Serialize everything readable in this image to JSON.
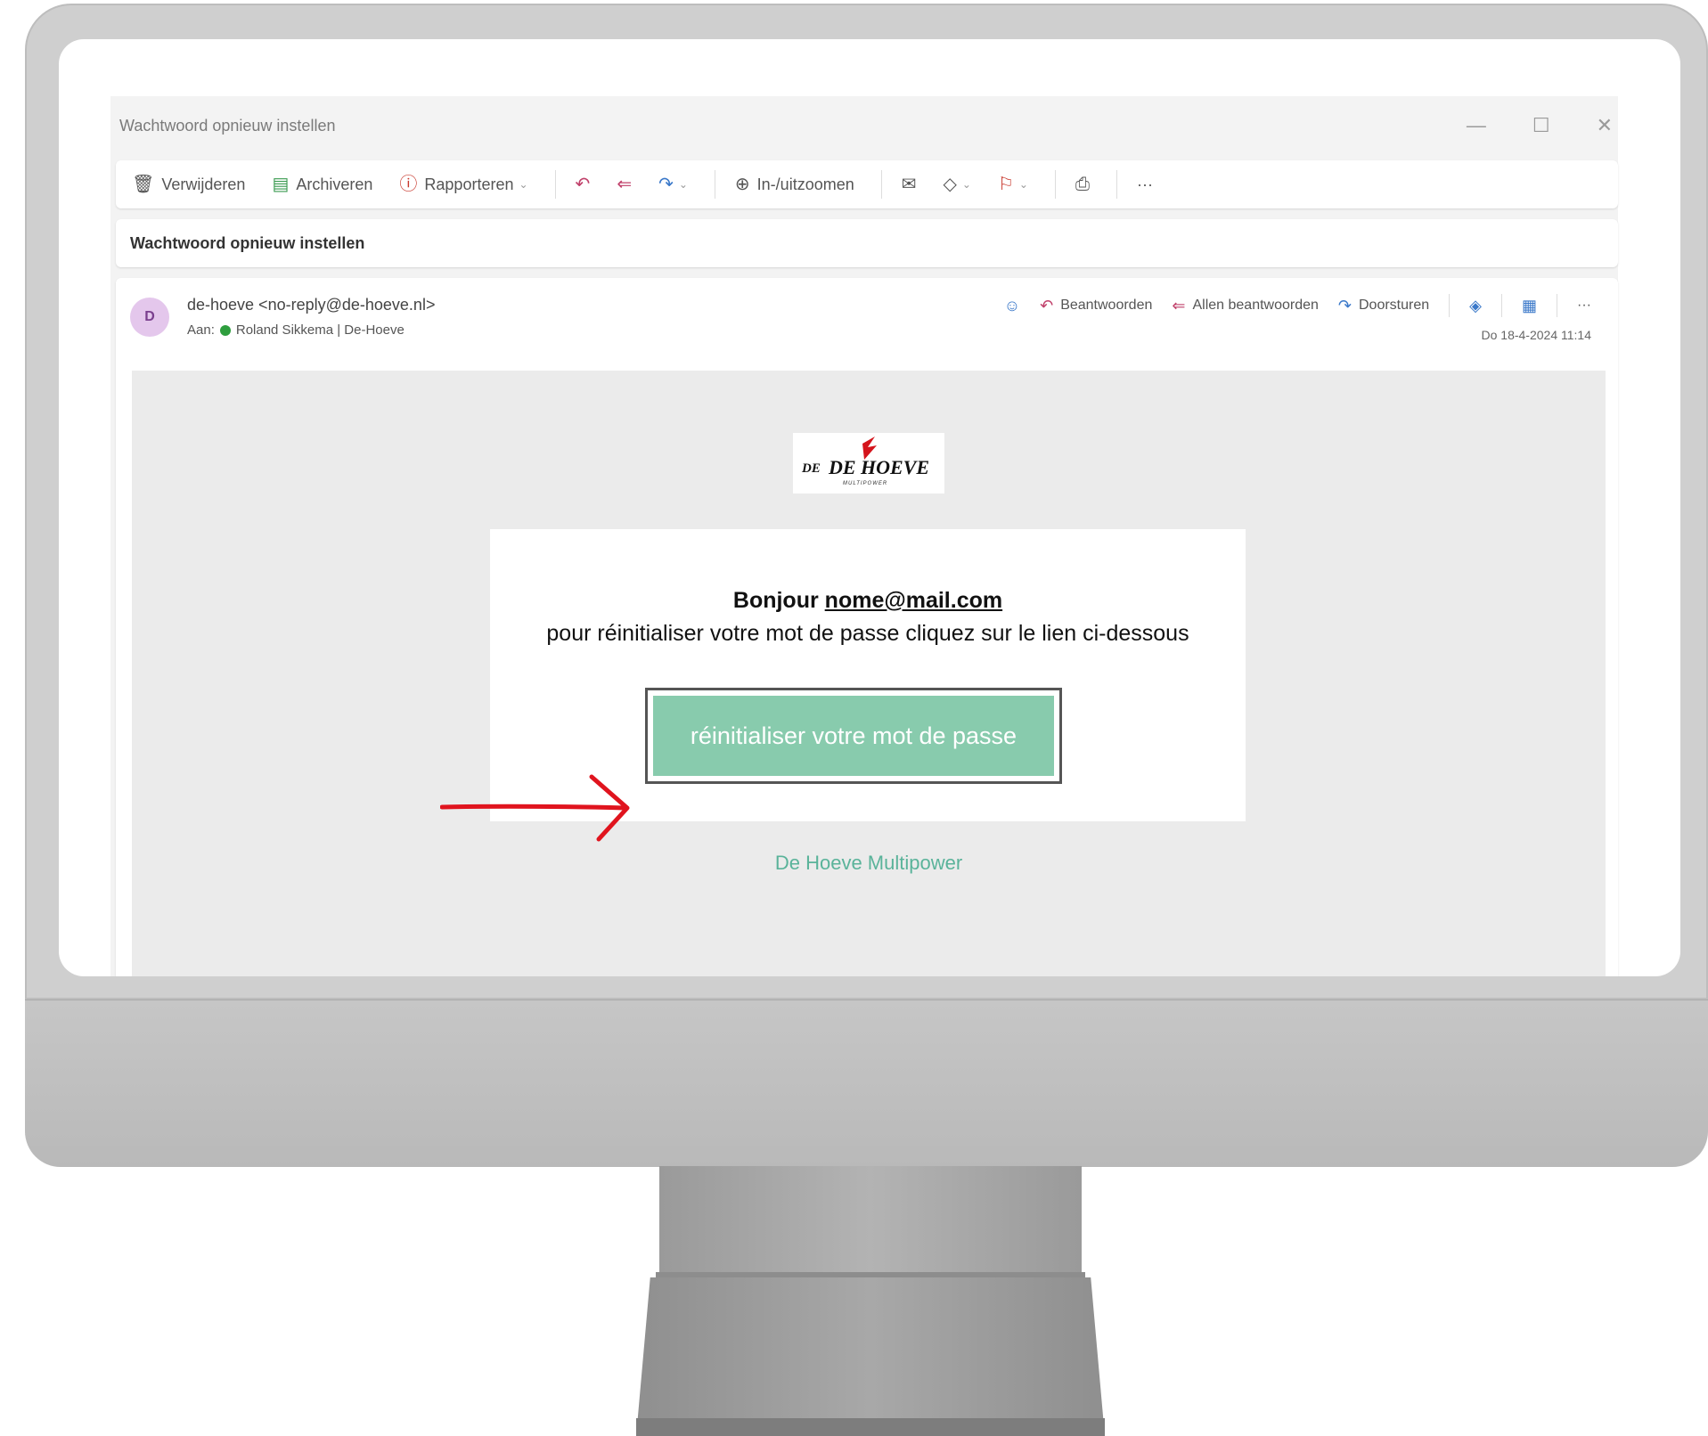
{
  "window": {
    "title": "Wachtwoord opnieuw instellen",
    "controls": {
      "minimize": "—",
      "maximize": "☐",
      "close": "✕"
    }
  },
  "toolbar": {
    "delete_label": "Verwijderen",
    "archive_label": "Archiveren",
    "report_label": "Rapporteren",
    "zoom_label": "In-/uitzoomen",
    "more_label": "···"
  },
  "subject": "Wachtwoord opnieuw instellen",
  "message": {
    "avatar_initial": "D",
    "sender": "de-hoeve <no-reply@de-hoeve.nl>",
    "to_prefix": "Aan:",
    "recipient": "Roland Sikkema | De-Hoeve",
    "reply_label": "Beantwoorden",
    "reply_all_label": "Allen beantwoorden",
    "forward_label": "Doorsturen",
    "more_label": "···",
    "timestamp": "Do 18-4-2024 11:14"
  },
  "email": {
    "logo_text": "DE HOEVE",
    "logo_subtext": "MULTIPOWER",
    "greeting_prefix": "Bonjour",
    "greeting_email": "nome@mail.com",
    "instruction": "pour réinitialiser votre mot de passe cliquez sur le lien ci-dessous",
    "button_label": "réinitialiser votre mot de passe",
    "footer": "De Hoeve Multipower"
  },
  "colors": {
    "button": "#88cbad",
    "footer_link": "#5ab39a",
    "annotation_arrow": "#e0141e",
    "avatar_bg": "#e4c7ec"
  }
}
